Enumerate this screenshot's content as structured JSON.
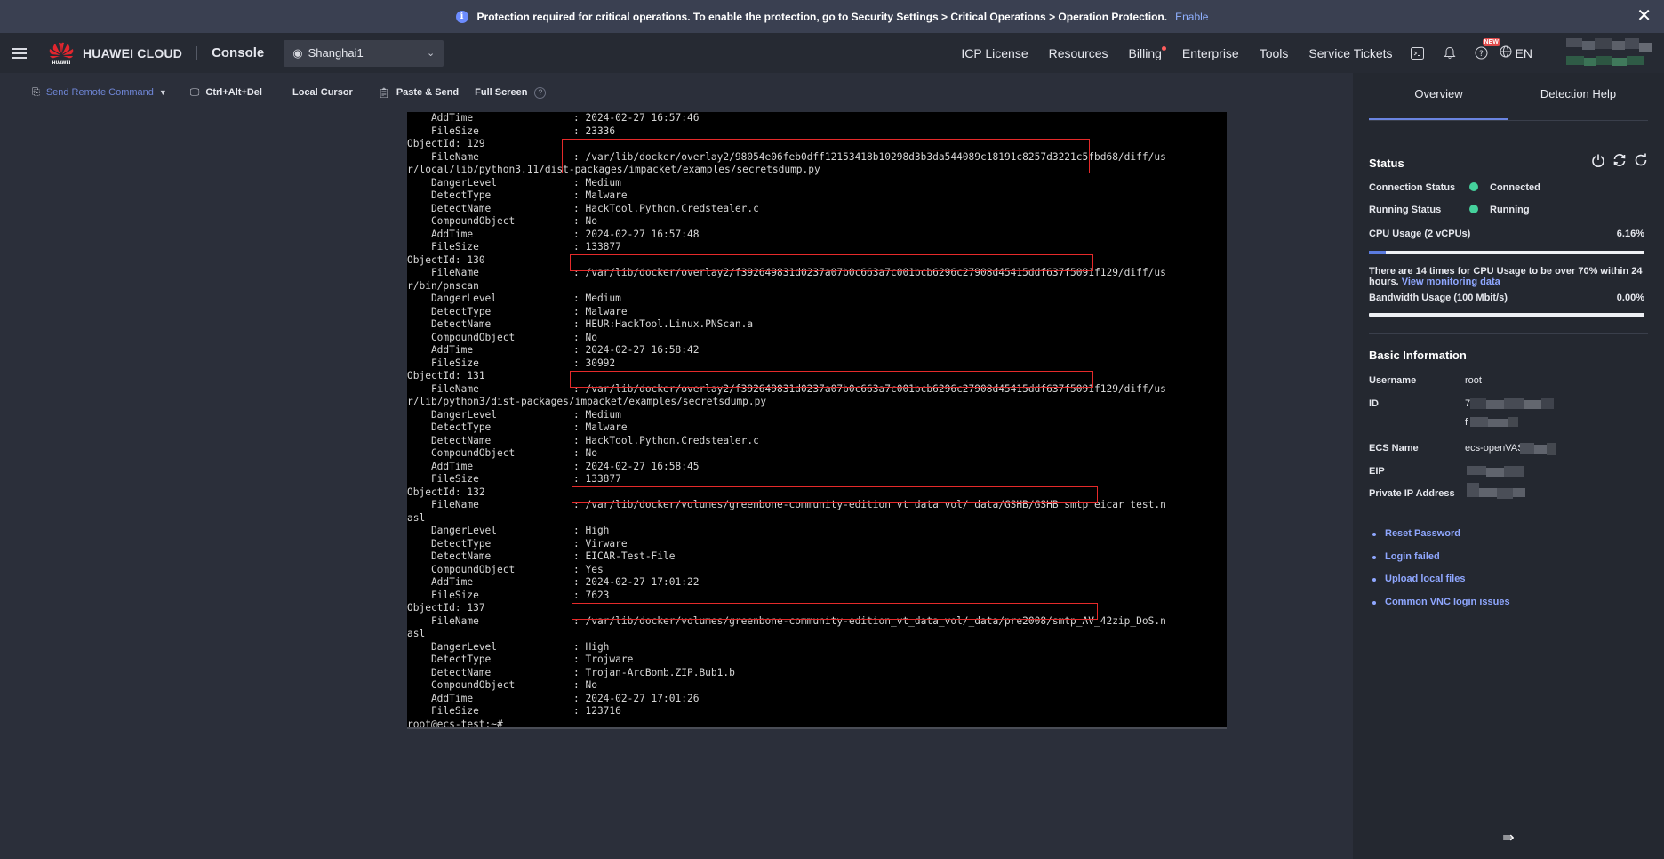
{
  "banner": {
    "message": "Protection required for critical operations. To enable the protection, go to Security Settings > Critical Operations > Operation Protection.",
    "enable_label": "Enable",
    "close_label": "✕"
  },
  "topnav": {
    "brand": "HUAWEI CLOUD",
    "logo_text": "HUAWEI",
    "console": "Console",
    "region": "Shanghai1",
    "items": [
      "ICP License",
      "Resources",
      "Billing",
      "Enterprise",
      "Tools",
      "Service Tickets"
    ],
    "new_badge": "NEW",
    "language": "EN"
  },
  "toolbar": {
    "send_remote_command": "Send Remote Command",
    "ctrl_alt_del": "Ctrl+Alt+Del",
    "local_cursor": "Local Cursor",
    "paste_send": "Paste & Send",
    "full_screen": "Full Screen",
    "help_glyph": "?"
  },
  "terminal": {
    "lines": [
      {
        "k": "    AddTime",
        "v": ": 2024-02-27 16:57:46"
      },
      {
        "k": "    FileSize",
        "v": ": 23336"
      },
      {
        "k": "ObjectId: 129",
        "v": ""
      },
      {
        "k": "    FileName",
        "v": ": /var/lib/docker/overlay2/98054e06feb0dff12153418b10298d3b3da544089c18191c8257d3221c5fbd68/diff/us"
      },
      {
        "k": "r/local/lib/python3.11/dist-packages/impacket/examples/secretsdump.py",
        "v": ""
      },
      {
        "k": "    DangerLevel",
        "v": ": Medium"
      },
      {
        "k": "    DetectType",
        "v": ": Malware"
      },
      {
        "k": "    DetectName",
        "v": ": HackTool.Python.Credstealer.c"
      },
      {
        "k": "    CompoundObject",
        "v": ": No"
      },
      {
        "k": "    AddTime",
        "v": ": 2024-02-27 16:57:48"
      },
      {
        "k": "    FileSize",
        "v": ": 133877"
      },
      {
        "k": "ObjectId: 130",
        "v": ""
      },
      {
        "k": "    FileName",
        "v": ": /var/lib/docker/overlay2/f392649831d0237a07b0c663a7c001bcb6296c27908d45415ddf637f5091f129/diff/us"
      },
      {
        "k": "r/bin/pnscan",
        "v": ""
      },
      {
        "k": "    DangerLevel",
        "v": ": Medium"
      },
      {
        "k": "    DetectType",
        "v": ": Malware"
      },
      {
        "k": "    DetectName",
        "v": ": HEUR:HackTool.Linux.PNScan.a"
      },
      {
        "k": "    CompoundObject",
        "v": ": No"
      },
      {
        "k": "    AddTime",
        "v": ": 2024-02-27 16:58:42"
      },
      {
        "k": "    FileSize",
        "v": ": 30992"
      },
      {
        "k": "ObjectId: 131",
        "v": ""
      },
      {
        "k": "    FileName",
        "v": ": /var/lib/docker/overlay2/f392649831d0237a07b0c663a7c001bcb6296c27908d45415ddf637f5091f129/diff/us"
      },
      {
        "k": "r/lib/python3/dist-packages/impacket/examples/secretsdump.py",
        "v": ""
      },
      {
        "k": "    DangerLevel",
        "v": ": Medium"
      },
      {
        "k": "    DetectType",
        "v": ": Malware"
      },
      {
        "k": "    DetectName",
        "v": ": HackTool.Python.Credstealer.c"
      },
      {
        "k": "    CompoundObject",
        "v": ": No"
      },
      {
        "k": "    AddTime",
        "v": ": 2024-02-27 16:58:45"
      },
      {
        "k": "    FileSize",
        "v": ": 133877"
      },
      {
        "k": "ObjectId: 132",
        "v": ""
      },
      {
        "k": "    FileName",
        "v": ": /var/lib/docker/volumes/greenbone-community-edition_vt_data_vol/_data/GSHB/GSHB_smtp_eicar_test.n"
      },
      {
        "k": "asl",
        "v": ""
      },
      {
        "k": "    DangerLevel",
        "v": ": High"
      },
      {
        "k": "    DetectType",
        "v": ": Virware"
      },
      {
        "k": "    DetectName",
        "v": ": EICAR-Test-File"
      },
      {
        "k": "    CompoundObject",
        "v": ": Yes"
      },
      {
        "k": "    AddTime",
        "v": ": 2024-02-27 17:01:22"
      },
      {
        "k": "    FileSize",
        "v": ": 7623"
      },
      {
        "k": "ObjectId: 137",
        "v": ""
      },
      {
        "k": "    FileName",
        "v": ": /var/lib/docker/volumes/greenbone-community-edition_vt_data_vol/_data/pre2008/smtp_AV_42zip_DoS.n"
      },
      {
        "k": "asl",
        "v": ""
      },
      {
        "k": "    DangerLevel",
        "v": ": High"
      },
      {
        "k": "    DetectType",
        "v": ": Trojware"
      },
      {
        "k": "    DetectName",
        "v": ": Trojan-ArcBomb.ZIP.Bub1.b"
      },
      {
        "k": "    CompoundObject",
        "v": ": No"
      },
      {
        "k": "    AddTime",
        "v": ": 2024-02-27 17:01:26"
      },
      {
        "k": "    FileSize",
        "v": ": 123716"
      }
    ],
    "prompt": "root@ecs-test:~# "
  },
  "panel": {
    "tabs": [
      "Overview",
      "Detection Help"
    ],
    "status_title": "Status",
    "connection_status_label": "Connection Status",
    "connection_status_value": "Connected",
    "running_status_label": "Running Status",
    "running_status_value": "Running",
    "cpu_label": "CPU Usage (2 vCPUs)",
    "cpu_value": "6.16%",
    "cpu_fraction": 0.0616,
    "cpu_note": "There are 14 times for CPU Usage to be over 70% within 24 hours.",
    "cpu_note_link": "View monitoring data",
    "bandwidth_label": "Bandwidth Usage (100 Mbit/s)",
    "bandwidth_value": "0.00%",
    "bandwidth_fraction": 0.0,
    "basic_title": "Basic Information",
    "username_label": "Username",
    "username_value": "root",
    "id_label": "ID",
    "id_prefix": "7",
    "id_prefix2": "f",
    "ecs_name_label": "ECS Name",
    "ecs_name_value": "ecs-openVAS",
    "eip_label": "EIP",
    "private_ip_label": "Private IP Address",
    "links": [
      "Reset Password",
      "Login failed",
      "Upload local files",
      "Common VNC login issues"
    ],
    "collapse_glyph": "⇛"
  },
  "colors": {
    "accent": "#6a84e0",
    "link": "#8fa7ff",
    "highlight_box": "#e52a2a",
    "status_ok": "#45d19c"
  }
}
